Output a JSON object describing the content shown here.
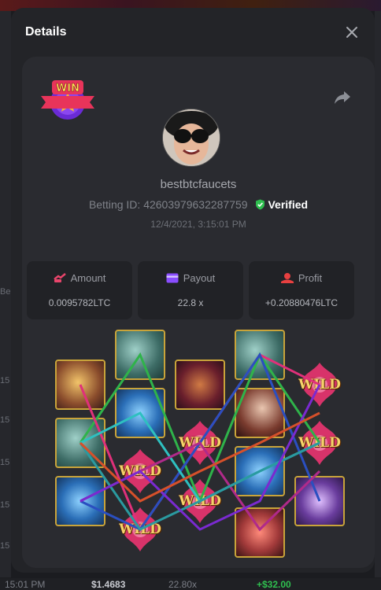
{
  "modal": {
    "title": "Details"
  },
  "player": {
    "username": "bestbtcfaucets",
    "betting_id_label": "Betting ID:",
    "betting_id": "42603979632287759",
    "verified_label": "Verified",
    "datetime": "12/4/2021, 3:15:01 PM",
    "badge_text": "WIN"
  },
  "stats": {
    "amount": {
      "label": "Amount",
      "value": "0.0095782LTC"
    },
    "payout": {
      "label": "Payout",
      "value": "22.8 x"
    },
    "profit": {
      "label": "Profit",
      "value": "+0.20880476LTC"
    }
  },
  "reels": {
    "wild_label": "WILD",
    "symbols": [
      [
        "comb",
        "book",
        "lotus"
      ],
      [
        "book",
        "lotus",
        "wild"
      ],
      [
        "pipa",
        "wild",
        "wild"
      ],
      [
        "book",
        "lady",
        "lotus",
        "lips"
      ],
      [
        "wild",
        "wild",
        "ring"
      ]
    ]
  },
  "background": {
    "time_stub": "15",
    "row_left_stub": "Be",
    "bottom_time": "15:01 PM",
    "bottom_amount": "$1.4683",
    "bottom_payout": "22.80x",
    "bottom_profit": "+$32.00"
  },
  "colors": {
    "verified_green": "#2fbf4f",
    "amount_icon": "#e8456b",
    "payout_icon": "#8a4dff",
    "profit_icon": "#e84040",
    "tile_border": "#c9a43a"
  }
}
